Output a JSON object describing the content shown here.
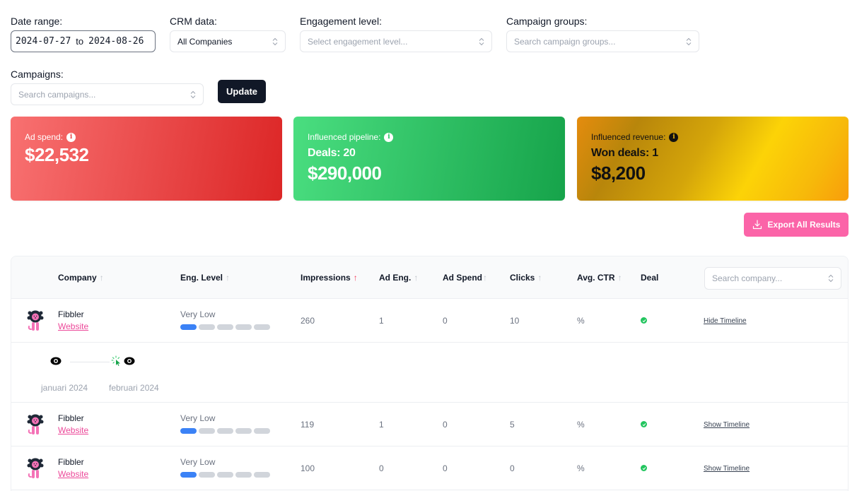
{
  "filters": {
    "date_range": {
      "label": "Date range:",
      "from": "2024-07-27",
      "separator": "to",
      "to": "2024-08-26"
    },
    "crm_data": {
      "label": "CRM data:",
      "value": "All Companies"
    },
    "engagement_level": {
      "label": "Engagement level:",
      "placeholder": "Select engagement level..."
    },
    "campaign_groups": {
      "label": "Campaign groups:",
      "placeholder": "Search campaign groups..."
    },
    "campaigns": {
      "label": "Campaigns:",
      "placeholder": "Search campaigns..."
    },
    "update_label": "Update"
  },
  "cards": {
    "ad_spend": {
      "title": "Ad spend:",
      "value": "$22,532",
      "color_from": "#f87171",
      "color_to": "#dc2626"
    },
    "pipeline": {
      "title": "Influenced pipeline:",
      "deals": "Deals: 20",
      "value": "$290,000",
      "color_from": "#4ade80",
      "color_to": "#16a34a"
    },
    "revenue": {
      "title": "Influenced revenue:",
      "won_deals": "Won deals: 1",
      "value": "$8,200",
      "color_from": "#e58c0e",
      "color_to": "#fcd307"
    }
  },
  "export_label": "Export All Results",
  "table": {
    "columns": [
      {
        "key": "company",
        "label": "Company",
        "sortable": true,
        "active": false
      },
      {
        "key": "eng_level",
        "label": "Eng. Level",
        "sortable": true,
        "active": false
      },
      {
        "key": "impressions",
        "label": "Impressions",
        "sortable": true,
        "active": true
      },
      {
        "key": "ad_eng",
        "label": "Ad Eng.",
        "sortable": true,
        "active": false
      },
      {
        "key": "ad_spend",
        "label": "Ad Spend",
        "sortable": true,
        "active": false
      },
      {
        "key": "clicks",
        "label": "Clicks",
        "sortable": true,
        "active": false
      },
      {
        "key": "avg_ctr",
        "label": "Avg. CTR",
        "sortable": true,
        "active": false
      },
      {
        "key": "deal",
        "label": "Deal",
        "sortable": false,
        "active": false
      }
    ],
    "search_placeholder": "Search company...",
    "rows": [
      {
        "company": "Fibbler",
        "website": "Website",
        "eng_level": "Very Low",
        "eng_level_score": 1,
        "eng_level_max": 5,
        "impressions": "260",
        "ad_eng": "1",
        "ad_spend": "0",
        "clicks": "10",
        "avg_ctr": "%",
        "deal": true,
        "timeline_label": "Hide Timeline"
      },
      {
        "company": "Fibbler",
        "website": "Website",
        "eng_level": "Very Low",
        "eng_level_score": 1,
        "eng_level_max": 5,
        "impressions": "119",
        "ad_eng": "1",
        "ad_spend": "0",
        "clicks": "5",
        "avg_ctr": "%",
        "deal": true,
        "timeline_label": "Show Timeline"
      },
      {
        "company": "Fibbler",
        "website": "Website",
        "eng_level": "Very Low",
        "eng_level_score": 1,
        "eng_level_max": 5,
        "impressions": "100",
        "ad_eng": "0",
        "ad_spend": "0",
        "clicks": "0",
        "avg_ctr": "%",
        "deal": true,
        "timeline_label": "Show Timeline"
      }
    ],
    "timeline": {
      "months": [
        "januari 2024",
        "februari 2024"
      ],
      "events": [
        {
          "month": "januari 2024",
          "type": "impression",
          "icon": "eye-icon"
        },
        {
          "month": "februari 2024",
          "type": "click",
          "icon": "cursor-click-icon"
        },
        {
          "month": "februari 2024",
          "type": "impression",
          "icon": "eye-icon"
        }
      ]
    }
  },
  "colors": {
    "primary_dark": "#111827",
    "accent_pink": "#fb64a8",
    "link_pink": "#ec4899",
    "sort_active": "#f43f5e",
    "deal_green": "#22c55e",
    "eng_active": "#3b82f6",
    "eng_inactive": "#d1d5db"
  }
}
